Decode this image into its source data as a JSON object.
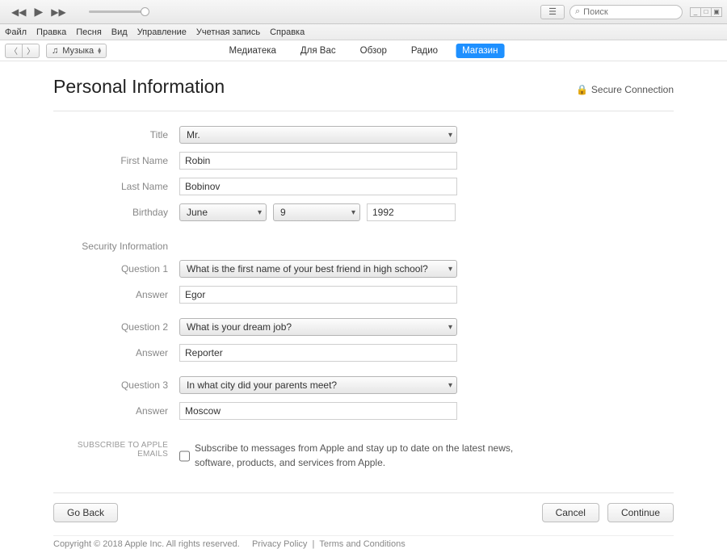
{
  "search": {
    "placeholder": "Поиск"
  },
  "menubar": [
    "Файл",
    "Правка",
    "Песня",
    "Вид",
    "Управление",
    "Учетная запись",
    "Справка"
  ],
  "media_picker": "Музыка",
  "navtabs": {
    "library": "Медиатека",
    "for_you": "Для Вас",
    "browse": "Обзор",
    "radio": "Радио",
    "store": "Магазин"
  },
  "page": {
    "title": "Personal Information",
    "secure": "Secure Connection"
  },
  "labels": {
    "title": "Title",
    "first_name": "First Name",
    "last_name": "Last Name",
    "birthday": "Birthday",
    "security_section": "Security Information",
    "q1": "Question 1",
    "q2": "Question 2",
    "q3": "Question 3",
    "answer": "Answer",
    "subscribe_section": "SUBSCRIBE TO APPLE EMAILS"
  },
  "values": {
    "title": "Mr.",
    "first_name": "Robin",
    "last_name": "Bobinov",
    "bday_month": "June",
    "bday_day": "9",
    "bday_year": "1992",
    "q1": "What is the first name of your best friend in high school?",
    "a1": "Egor",
    "q2": "What is your dream job?",
    "a2": "Reporter",
    "q3": "In what city did your parents meet?",
    "a3": "Moscow",
    "subscribe_text": "Subscribe to messages from Apple and stay up to date on the latest news, software, products, and services from Apple."
  },
  "buttons": {
    "go_back": "Go Back",
    "cancel": "Cancel",
    "continue": "Continue"
  },
  "footer": {
    "copyright": "Copyright © 2018 Apple Inc. All rights reserved.",
    "privacy": "Privacy Policy",
    "terms": "Terms and Conditions"
  }
}
